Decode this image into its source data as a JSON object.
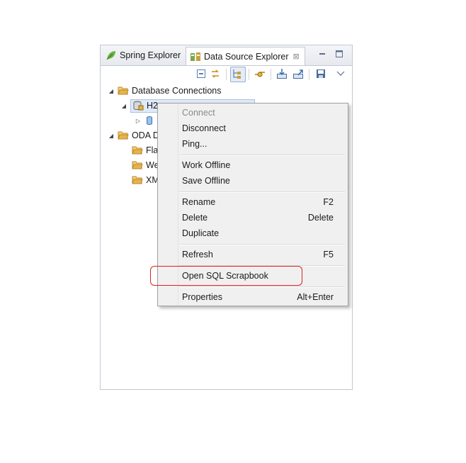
{
  "tabs": [
    {
      "label": "Spring Explorer",
      "icon": "spring-leaf-icon",
      "active": false
    },
    {
      "label": "Data Source Explorer",
      "icon": "data-source-icon",
      "active": true,
      "close": "⊠"
    }
  ],
  "tree": {
    "database_connections": "Database Connections",
    "h2_partial": "H2",
    "oda_partial": "ODA D",
    "oda_children": [
      "Fla",
      "We",
      "XM"
    ]
  },
  "context_menu": {
    "items": [
      {
        "label": "Connect",
        "shortcut": "",
        "disabled": true
      },
      {
        "label": "Disconnect",
        "shortcut": ""
      },
      {
        "label": "Ping...",
        "shortcut": ""
      },
      {
        "label": "Work Offline",
        "shortcut": ""
      },
      {
        "label": "Save Offline",
        "shortcut": ""
      },
      {
        "label": "Rename",
        "shortcut": "F2"
      },
      {
        "label": "Delete",
        "shortcut": "Delete"
      },
      {
        "label": "Duplicate",
        "shortcut": ""
      },
      {
        "label": "Refresh",
        "shortcut": "F5"
      },
      {
        "label": "Open SQL Scrapbook",
        "shortcut": ""
      },
      {
        "label": "Properties",
        "shortcut": "Alt+Enter"
      }
    ]
  },
  "colors": {
    "highlight": "#e02020",
    "selection": "#dfe9f7",
    "folder": "#e8b44a"
  }
}
